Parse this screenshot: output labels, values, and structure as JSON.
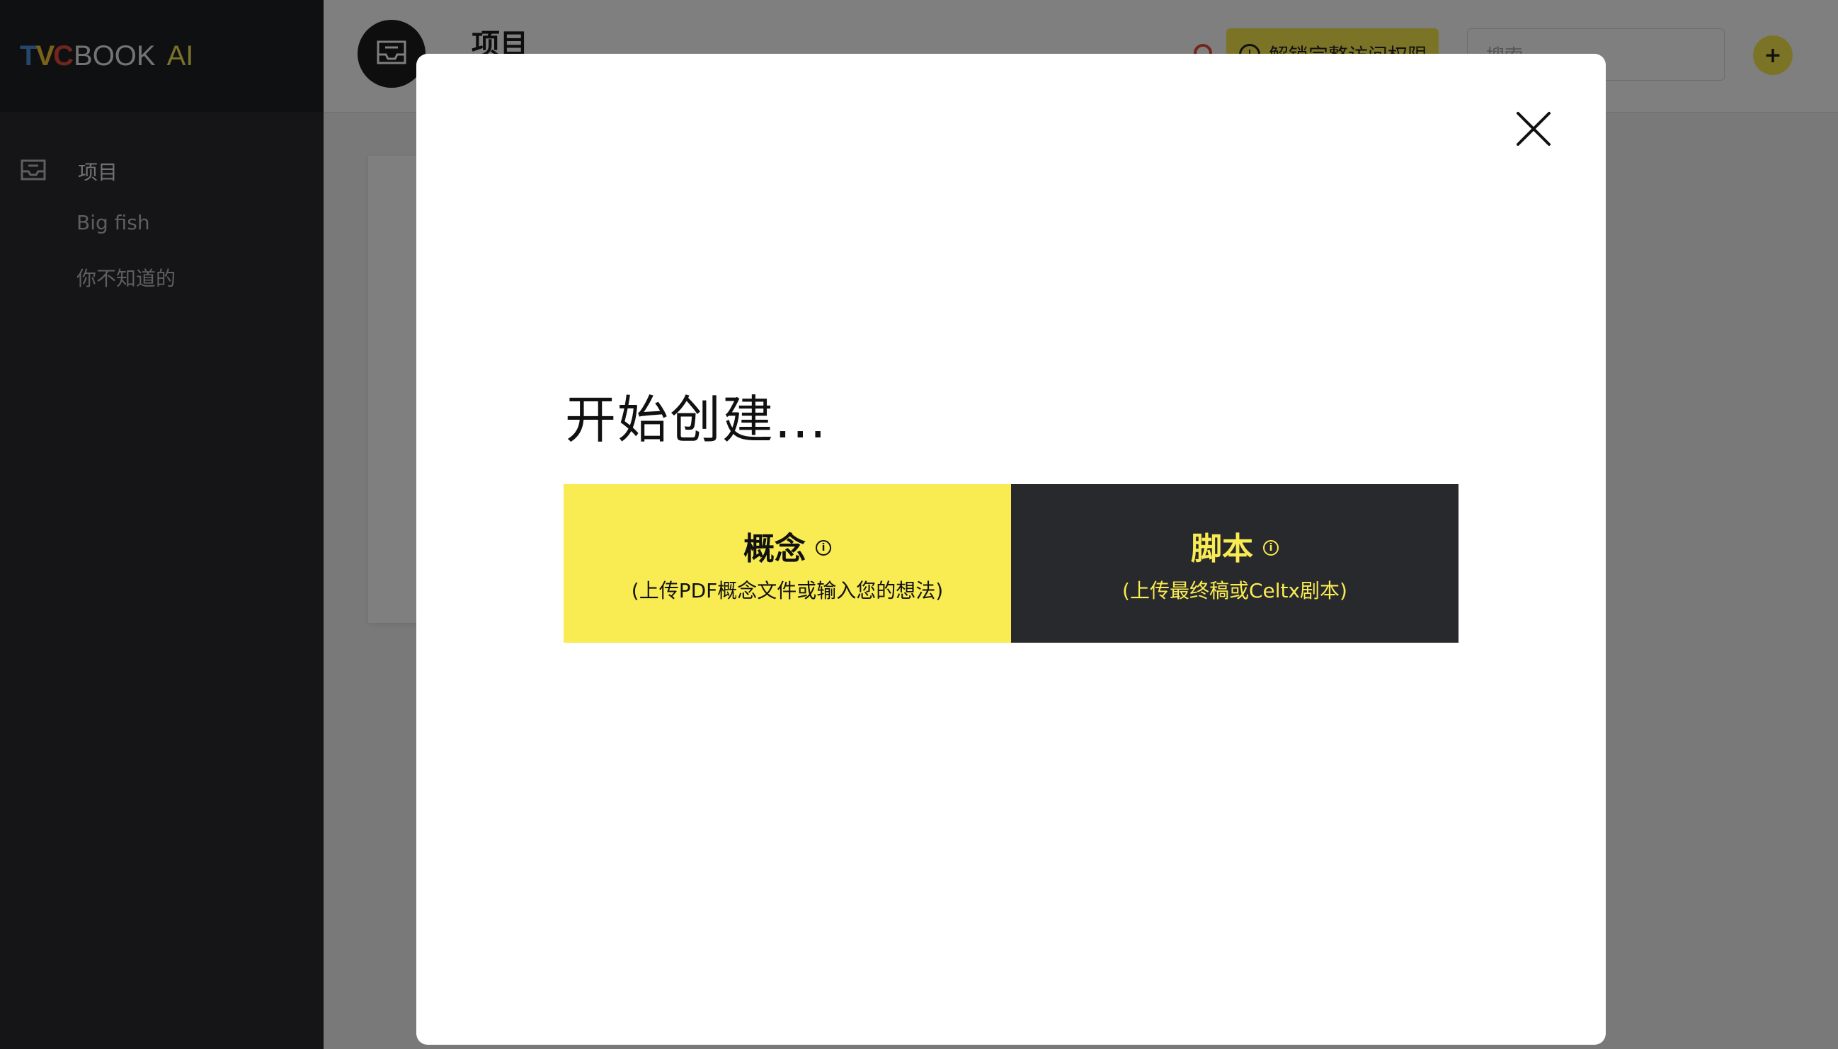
{
  "app": {
    "logo": {
      "t": "T",
      "v": "V",
      "c": "C",
      "book": "BOOK",
      "ai": "AI"
    }
  },
  "sidebar": {
    "projects_label": "项目",
    "items": [
      {
        "label": "Big fish"
      },
      {
        "label": "你不知道的"
      }
    ]
  },
  "header": {
    "title": "项目",
    "unlock_label": "解锁完整访问权限",
    "search_placeholder": "搜索",
    "add_label": "+"
  },
  "modal": {
    "title": "开始创建...",
    "options": [
      {
        "label": "概念",
        "description": "(上传PDF概念文件或输入您的想法)",
        "info_icon": "i"
      },
      {
        "label": "脚本",
        "description": "(上传最终稿或Celtx剧本)",
        "info_icon": "i"
      }
    ]
  },
  "colors": {
    "accent_yellow": "#f9eb52",
    "dark": "#28292c",
    "sidebar": "#2a2b30"
  }
}
